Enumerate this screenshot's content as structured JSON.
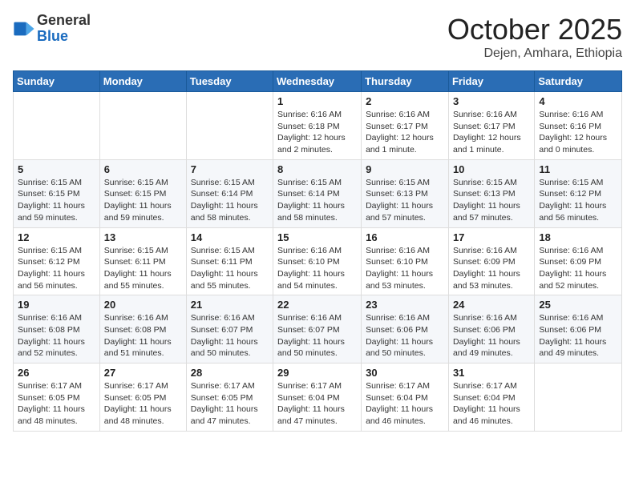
{
  "header": {
    "logo_general": "General",
    "logo_blue": "Blue",
    "month": "October 2025",
    "location": "Dejen, Amhara, Ethiopia"
  },
  "days_of_week": [
    "Sunday",
    "Monday",
    "Tuesday",
    "Wednesday",
    "Thursday",
    "Friday",
    "Saturday"
  ],
  "weeks": [
    [
      {
        "day": "",
        "info": ""
      },
      {
        "day": "",
        "info": ""
      },
      {
        "day": "",
        "info": ""
      },
      {
        "day": "1",
        "info": "Sunrise: 6:16 AM\nSunset: 6:18 PM\nDaylight: 12 hours\nand 2 minutes."
      },
      {
        "day": "2",
        "info": "Sunrise: 6:16 AM\nSunset: 6:17 PM\nDaylight: 12 hours\nand 1 minute."
      },
      {
        "day": "3",
        "info": "Sunrise: 6:16 AM\nSunset: 6:17 PM\nDaylight: 12 hours\nand 1 minute."
      },
      {
        "day": "4",
        "info": "Sunrise: 6:16 AM\nSunset: 6:16 PM\nDaylight: 12 hours\nand 0 minutes."
      }
    ],
    [
      {
        "day": "5",
        "info": "Sunrise: 6:15 AM\nSunset: 6:15 PM\nDaylight: 11 hours\nand 59 minutes."
      },
      {
        "day": "6",
        "info": "Sunrise: 6:15 AM\nSunset: 6:15 PM\nDaylight: 11 hours\nand 59 minutes."
      },
      {
        "day": "7",
        "info": "Sunrise: 6:15 AM\nSunset: 6:14 PM\nDaylight: 11 hours\nand 58 minutes."
      },
      {
        "day": "8",
        "info": "Sunrise: 6:15 AM\nSunset: 6:14 PM\nDaylight: 11 hours\nand 58 minutes."
      },
      {
        "day": "9",
        "info": "Sunrise: 6:15 AM\nSunset: 6:13 PM\nDaylight: 11 hours\nand 57 minutes."
      },
      {
        "day": "10",
        "info": "Sunrise: 6:15 AM\nSunset: 6:13 PM\nDaylight: 11 hours\nand 57 minutes."
      },
      {
        "day": "11",
        "info": "Sunrise: 6:15 AM\nSunset: 6:12 PM\nDaylight: 11 hours\nand 56 minutes."
      }
    ],
    [
      {
        "day": "12",
        "info": "Sunrise: 6:15 AM\nSunset: 6:12 PM\nDaylight: 11 hours\nand 56 minutes."
      },
      {
        "day": "13",
        "info": "Sunrise: 6:15 AM\nSunset: 6:11 PM\nDaylight: 11 hours\nand 55 minutes."
      },
      {
        "day": "14",
        "info": "Sunrise: 6:15 AM\nSunset: 6:11 PM\nDaylight: 11 hours\nand 55 minutes."
      },
      {
        "day": "15",
        "info": "Sunrise: 6:16 AM\nSunset: 6:10 PM\nDaylight: 11 hours\nand 54 minutes."
      },
      {
        "day": "16",
        "info": "Sunrise: 6:16 AM\nSunset: 6:10 PM\nDaylight: 11 hours\nand 53 minutes."
      },
      {
        "day": "17",
        "info": "Sunrise: 6:16 AM\nSunset: 6:09 PM\nDaylight: 11 hours\nand 53 minutes."
      },
      {
        "day": "18",
        "info": "Sunrise: 6:16 AM\nSunset: 6:09 PM\nDaylight: 11 hours\nand 52 minutes."
      }
    ],
    [
      {
        "day": "19",
        "info": "Sunrise: 6:16 AM\nSunset: 6:08 PM\nDaylight: 11 hours\nand 52 minutes."
      },
      {
        "day": "20",
        "info": "Sunrise: 6:16 AM\nSunset: 6:08 PM\nDaylight: 11 hours\nand 51 minutes."
      },
      {
        "day": "21",
        "info": "Sunrise: 6:16 AM\nSunset: 6:07 PM\nDaylight: 11 hours\nand 50 minutes."
      },
      {
        "day": "22",
        "info": "Sunrise: 6:16 AM\nSunset: 6:07 PM\nDaylight: 11 hours\nand 50 minutes."
      },
      {
        "day": "23",
        "info": "Sunrise: 6:16 AM\nSunset: 6:06 PM\nDaylight: 11 hours\nand 50 minutes."
      },
      {
        "day": "24",
        "info": "Sunrise: 6:16 AM\nSunset: 6:06 PM\nDaylight: 11 hours\nand 49 minutes."
      },
      {
        "day": "25",
        "info": "Sunrise: 6:16 AM\nSunset: 6:06 PM\nDaylight: 11 hours\nand 49 minutes."
      }
    ],
    [
      {
        "day": "26",
        "info": "Sunrise: 6:17 AM\nSunset: 6:05 PM\nDaylight: 11 hours\nand 48 minutes."
      },
      {
        "day": "27",
        "info": "Sunrise: 6:17 AM\nSunset: 6:05 PM\nDaylight: 11 hours\nand 48 minutes."
      },
      {
        "day": "28",
        "info": "Sunrise: 6:17 AM\nSunset: 6:05 PM\nDaylight: 11 hours\nand 47 minutes."
      },
      {
        "day": "29",
        "info": "Sunrise: 6:17 AM\nSunset: 6:04 PM\nDaylight: 11 hours\nand 47 minutes."
      },
      {
        "day": "30",
        "info": "Sunrise: 6:17 AM\nSunset: 6:04 PM\nDaylight: 11 hours\nand 46 minutes."
      },
      {
        "day": "31",
        "info": "Sunrise: 6:17 AM\nSunset: 6:04 PM\nDaylight: 11 hours\nand 46 minutes."
      },
      {
        "day": "",
        "info": ""
      }
    ]
  ]
}
